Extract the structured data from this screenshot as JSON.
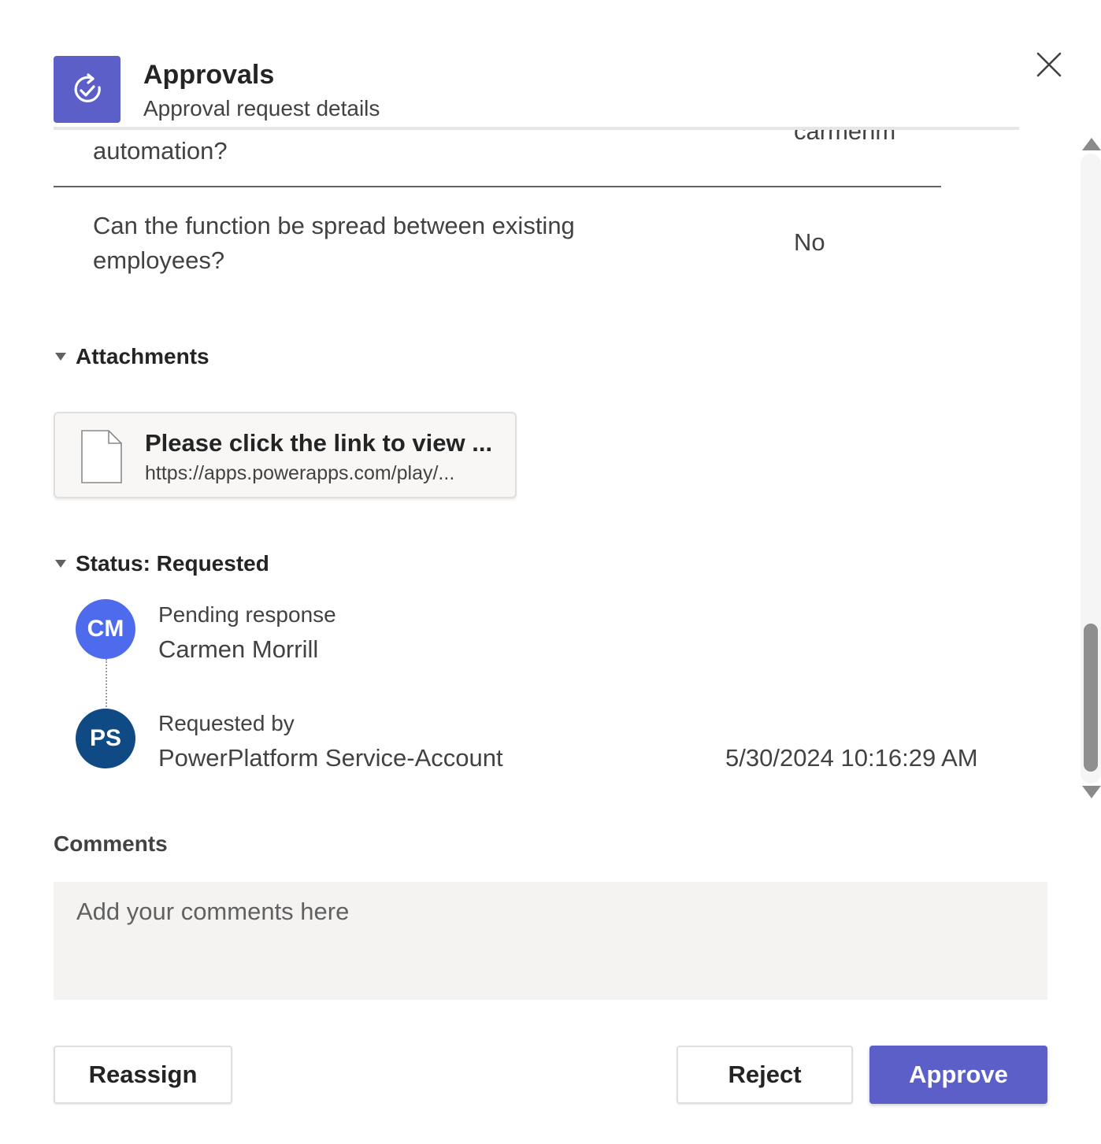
{
  "header": {
    "app_title": "Approvals",
    "subtitle": "Approval request details",
    "app_icon": "approvals-icon",
    "close_icon": "close-icon",
    "brand_color": "#5b5fc7"
  },
  "details": {
    "partial_question": "automation?",
    "partial_value": "carmenm",
    "question_line1": "Can the function be spread between existing",
    "question_line2": "employees?",
    "answer": "No"
  },
  "attachments": {
    "heading": "Attachments",
    "item": {
      "title": "Please click the link to view ...",
      "url": "https://apps.powerapps.com/play/...",
      "icon": "document-icon"
    }
  },
  "status": {
    "heading": "Status: Requested",
    "entries": [
      {
        "initials": "CM",
        "label": "Pending response",
        "name": "Carmen Morrill",
        "timestamp": "",
        "color": "#4f6bed"
      },
      {
        "initials": "PS",
        "label": "Requested by",
        "name": "PowerPlatform Service-Account",
        "timestamp": "5/30/2024 10:16:29 AM",
        "color": "#0f4a85"
      }
    ]
  },
  "comments": {
    "label": "Comments",
    "placeholder": "Add your comments here",
    "value": ""
  },
  "actions": {
    "reassign": "Reassign",
    "reject": "Reject",
    "approve": "Approve"
  }
}
